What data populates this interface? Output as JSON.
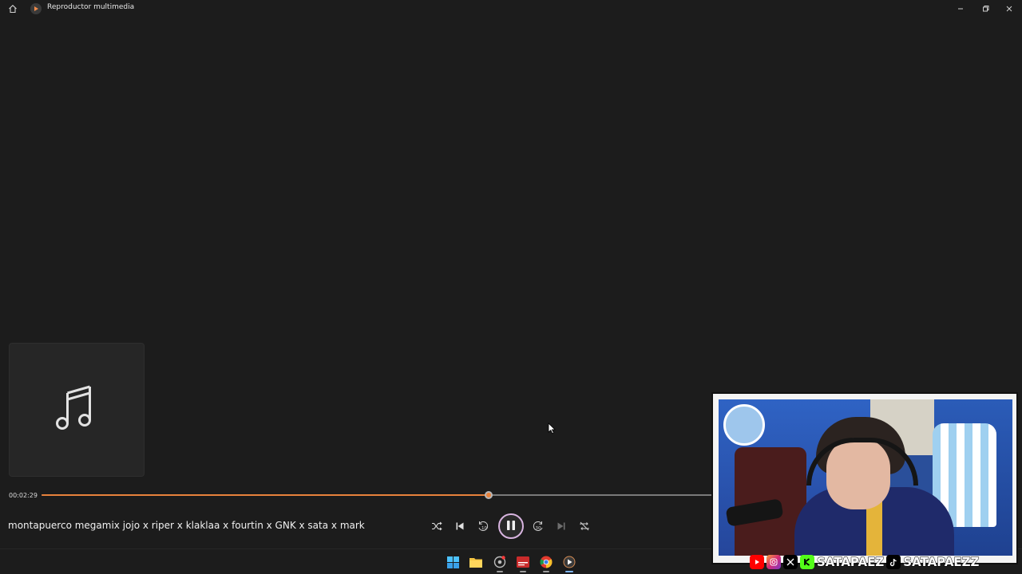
{
  "window": {
    "title": "Reproductor multimedia",
    "home_icon": "home-icon",
    "app_icon": "media-player-icon",
    "controls": [
      "minimize-icon",
      "restore-icon",
      "close-icon"
    ]
  },
  "album_art": {
    "icon": "music-note-icon"
  },
  "playback": {
    "elapsed": "00:02:29",
    "progress_fraction": 0.667,
    "accent_color": "#e8823c"
  },
  "now_playing": {
    "title": "montapuerco megamix jojo x riper x klaklaa x fourtin x GNK x sata x mark"
  },
  "controls": {
    "shuffle": "shuffle-icon",
    "previous": "previous-icon",
    "rewind": "rewind-10-icon",
    "rewind_label": "10",
    "play_pause": "pause-icon",
    "forward": "forward-30-icon",
    "forward_label": "30",
    "next": "next-icon",
    "repeat": "repeat-off-icon"
  },
  "taskbar": {
    "items": [
      "windows-start-icon",
      "file-explorer-icon",
      "app-icon",
      "video-app-icon",
      "chrome-icon",
      "media-player-icon"
    ]
  },
  "webcam": {
    "social_handles": [
      "SATAPAEZ",
      "SATAPAEZZ"
    ]
  }
}
